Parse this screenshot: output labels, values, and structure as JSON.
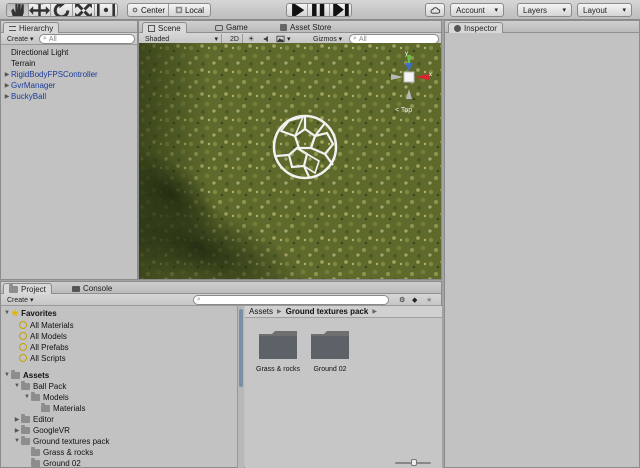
{
  "toolbar": {
    "tools": [
      "hand",
      "move",
      "rotate",
      "scale",
      "rect"
    ],
    "pivot_label": "Center",
    "space_label": "Local",
    "account_label": "Account",
    "layers_label": "Layers",
    "layout_label": "Layout"
  },
  "hierarchy": {
    "tab_label": "Hierarchy",
    "create_label": "Create",
    "search_placeholder": "All",
    "items": [
      {
        "label": "Directional Light",
        "expandable": false,
        "prefab": false
      },
      {
        "label": "Terrain",
        "expandable": false,
        "prefab": false
      },
      {
        "label": "RigidBodyFPSController",
        "expandable": true,
        "prefab": true
      },
      {
        "label": "GvrManager",
        "expandable": true,
        "prefab": true
      },
      {
        "label": "BuckyBall",
        "expandable": true,
        "prefab": true
      }
    ]
  },
  "scene": {
    "tabs": [
      "Scene",
      "Game",
      "Asset Store"
    ],
    "shading_label": "Shaded",
    "mode_2d_label": "2D",
    "gizmos_label": "Gizmos",
    "search_placeholder": "All",
    "gizmo_y": "y",
    "gizmo_x": "x",
    "view_label": "Top"
  },
  "inspector": {
    "tab_label": "Inspector"
  },
  "project": {
    "tabs": [
      "Project",
      "Console"
    ],
    "create_label": "Create",
    "favorites_label": "Favorites",
    "favorites": [
      "All Materials",
      "All Models",
      "All Prefabs",
      "All Scripts"
    ],
    "assets_label": "Assets",
    "tree": [
      {
        "label": "Ball Pack",
        "depth": 1,
        "open": true
      },
      {
        "label": "Models",
        "depth": 2,
        "open": true
      },
      {
        "label": "Materials",
        "depth": 3,
        "open": false
      },
      {
        "label": "Editor",
        "depth": 1,
        "open": false
      },
      {
        "label": "GoogleVR",
        "depth": 1,
        "open": false
      },
      {
        "label": "Ground textures pack",
        "depth": 1,
        "open": true
      },
      {
        "label": "Grass & rocks",
        "depth": 2,
        "open": false
      },
      {
        "label": "Ground 02",
        "depth": 2,
        "open": false
      }
    ],
    "breadcrumb": [
      "Assets",
      "Ground textures pack"
    ],
    "folders": [
      "Grass & rocks",
      "Ground 02"
    ]
  },
  "colors": {
    "accent_blue": "#1a3a9a",
    "gizmo_red": "#d8262c",
    "gizmo_green": "#6bc043",
    "gizmo_blue": "#3c6bd8"
  }
}
